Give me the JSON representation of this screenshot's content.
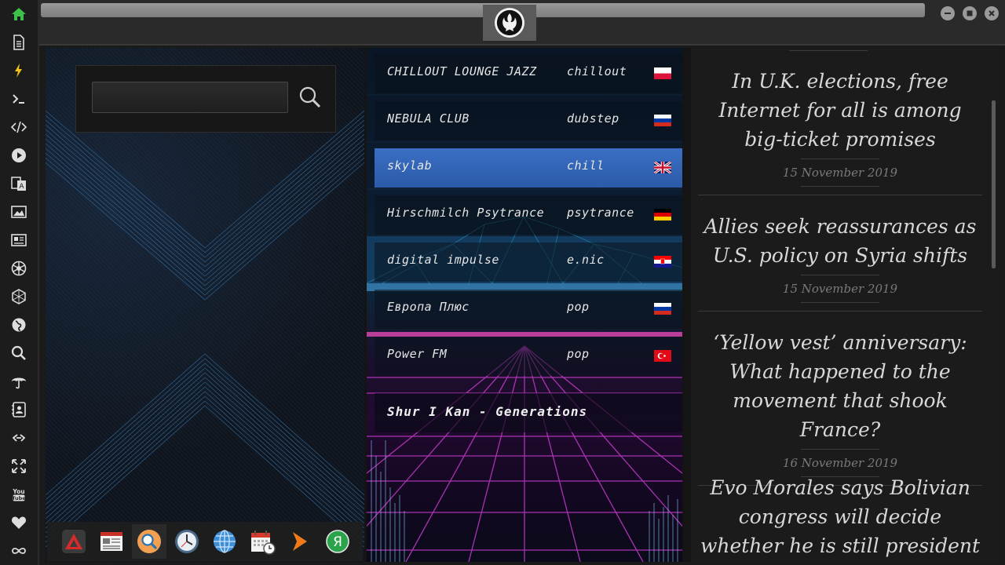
{
  "sidebar": {
    "items": [
      {
        "icon": "home-icon"
      },
      {
        "icon": "document-icon"
      },
      {
        "icon": "lightning-icon"
      },
      {
        "icon": "terminal-icon"
      },
      {
        "icon": "code-icon"
      },
      {
        "icon": "play-icon"
      },
      {
        "icon": "translate-icon"
      },
      {
        "icon": "image-icon"
      },
      {
        "icon": "news-icon"
      },
      {
        "icon": "aperture-icon"
      },
      {
        "icon": "hexagon-icon"
      },
      {
        "icon": "globe-icon"
      },
      {
        "icon": "search-icon"
      },
      {
        "icon": "umbrella-icon"
      },
      {
        "icon": "contacts-icon"
      },
      {
        "icon": "link-icon"
      },
      {
        "icon": "fullscreen-icon"
      },
      {
        "icon": "youtube-icon"
      },
      {
        "icon": "heart-icon"
      },
      {
        "icon": "infinity-icon"
      }
    ],
    "active_color": "#3cc24a"
  },
  "window": {
    "logo": "rebel-alliance-logo"
  },
  "search": {
    "value": "",
    "placeholder": ""
  },
  "stations": [
    {
      "name": "CHILLOUT LOUNGE JAZZ",
      "genre": "chillout",
      "flag": "poland"
    },
    {
      "name": "NEBULA CLUB",
      "genre": "dubstep",
      "flag": "russia"
    },
    {
      "name": "skylab",
      "genre": "chill",
      "flag": "united-kingdom",
      "selected": true
    },
    {
      "name": "Hirschmilch Psytrance",
      "genre": "psytrance",
      "flag": "germany"
    },
    {
      "name": "digital impulse",
      "genre": "e.nic",
      "flag": "croatia"
    },
    {
      "name": "Европа Плюс",
      "genre": "pop",
      "flag": "russia"
    },
    {
      "name": "Power FM",
      "genre": "pop",
      "flag": "turkey"
    }
  ],
  "now_playing": "Shur I Kan - Generations",
  "news": [
    {
      "title": "In U.K. elections, free Internet for all is among big-ticket promises",
      "date": "15 November 2019"
    },
    {
      "title": "Allies seek reassurances as U.S. policy on Syria shifts",
      "date": "15 November 2019"
    },
    {
      "title": "‘Yellow vest’ anniversary: What happened to the movement that shook France?",
      "date": "16 November 2019"
    },
    {
      "title": "Evo Morales says Bolivian congress will decide whether he is still president",
      "date": ""
    }
  ],
  "dock": [
    {
      "icon": "red-triangle-app-icon"
    },
    {
      "icon": "calendar-newspaper-icon"
    },
    {
      "icon": "search-app-icon",
      "active": true
    },
    {
      "icon": "clock-icon"
    },
    {
      "icon": "globe-browser-icon"
    },
    {
      "icon": "calendar-clock-icon"
    },
    {
      "icon": "orange-arrow-icon"
    },
    {
      "icon": "yandex-icon"
    }
  ]
}
